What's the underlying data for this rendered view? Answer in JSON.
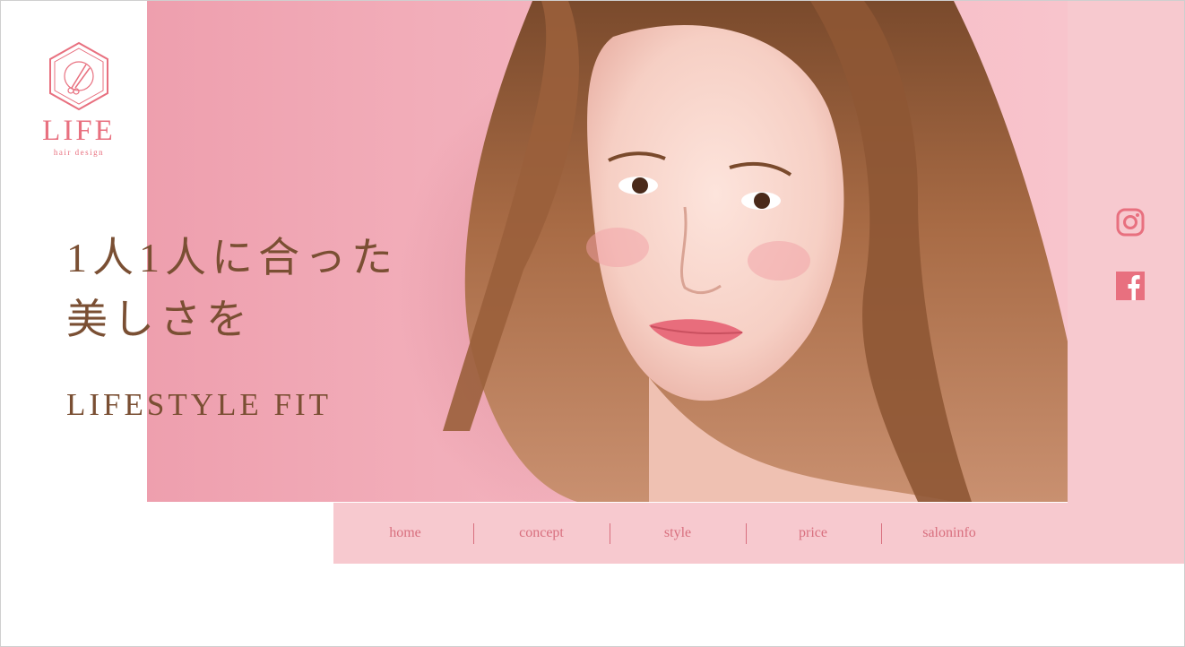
{
  "logo": {
    "name": "LIFE",
    "sub": "hair design",
    "icon": "scissors-hexagon-icon"
  },
  "hero": {
    "headline_line1": "1人1人に合った",
    "headline_line2": "美しさを",
    "tagline": "LIFESTYLE FIT",
    "image": "smiling-woman-wavy-hair-photo"
  },
  "nav": {
    "items": [
      {
        "label": "home"
      },
      {
        "label": "concept"
      },
      {
        "label": "style"
      },
      {
        "label": "price"
      },
      {
        "label": "saloninfo"
      }
    ]
  },
  "social": {
    "instagram_icon": "instagram-icon",
    "facebook_icon": "facebook-icon"
  },
  "colors": {
    "accent_pink": "#e8707f",
    "panel_pink": "#f7c9cf",
    "nav_text": "#d86f7e",
    "headline_brown": "#7a4f33",
    "hero_background": "#f2adb9"
  }
}
